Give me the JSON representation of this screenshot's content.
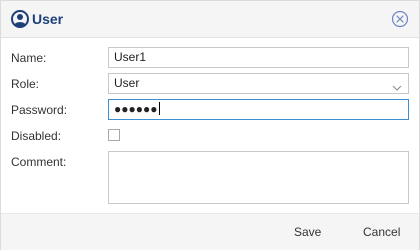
{
  "dialog": {
    "title": "User",
    "icons": {
      "title": "user-icon",
      "close": "close-circle-icon"
    },
    "colors": {
      "title": "#1f3f79",
      "close": "#6c86c5",
      "focus_border": "#3d8fd3"
    }
  },
  "form": {
    "name": {
      "label": "Name:",
      "value": "User1"
    },
    "role": {
      "label": "Role:",
      "value": "User"
    },
    "password": {
      "label": "Password:",
      "value": "●●●●●●"
    },
    "disabled": {
      "label": "Disabled:",
      "checked": false
    },
    "comment": {
      "label": "Comment:",
      "value": ""
    }
  },
  "footer": {
    "save_label": "Save",
    "cancel_label": "Cancel"
  }
}
